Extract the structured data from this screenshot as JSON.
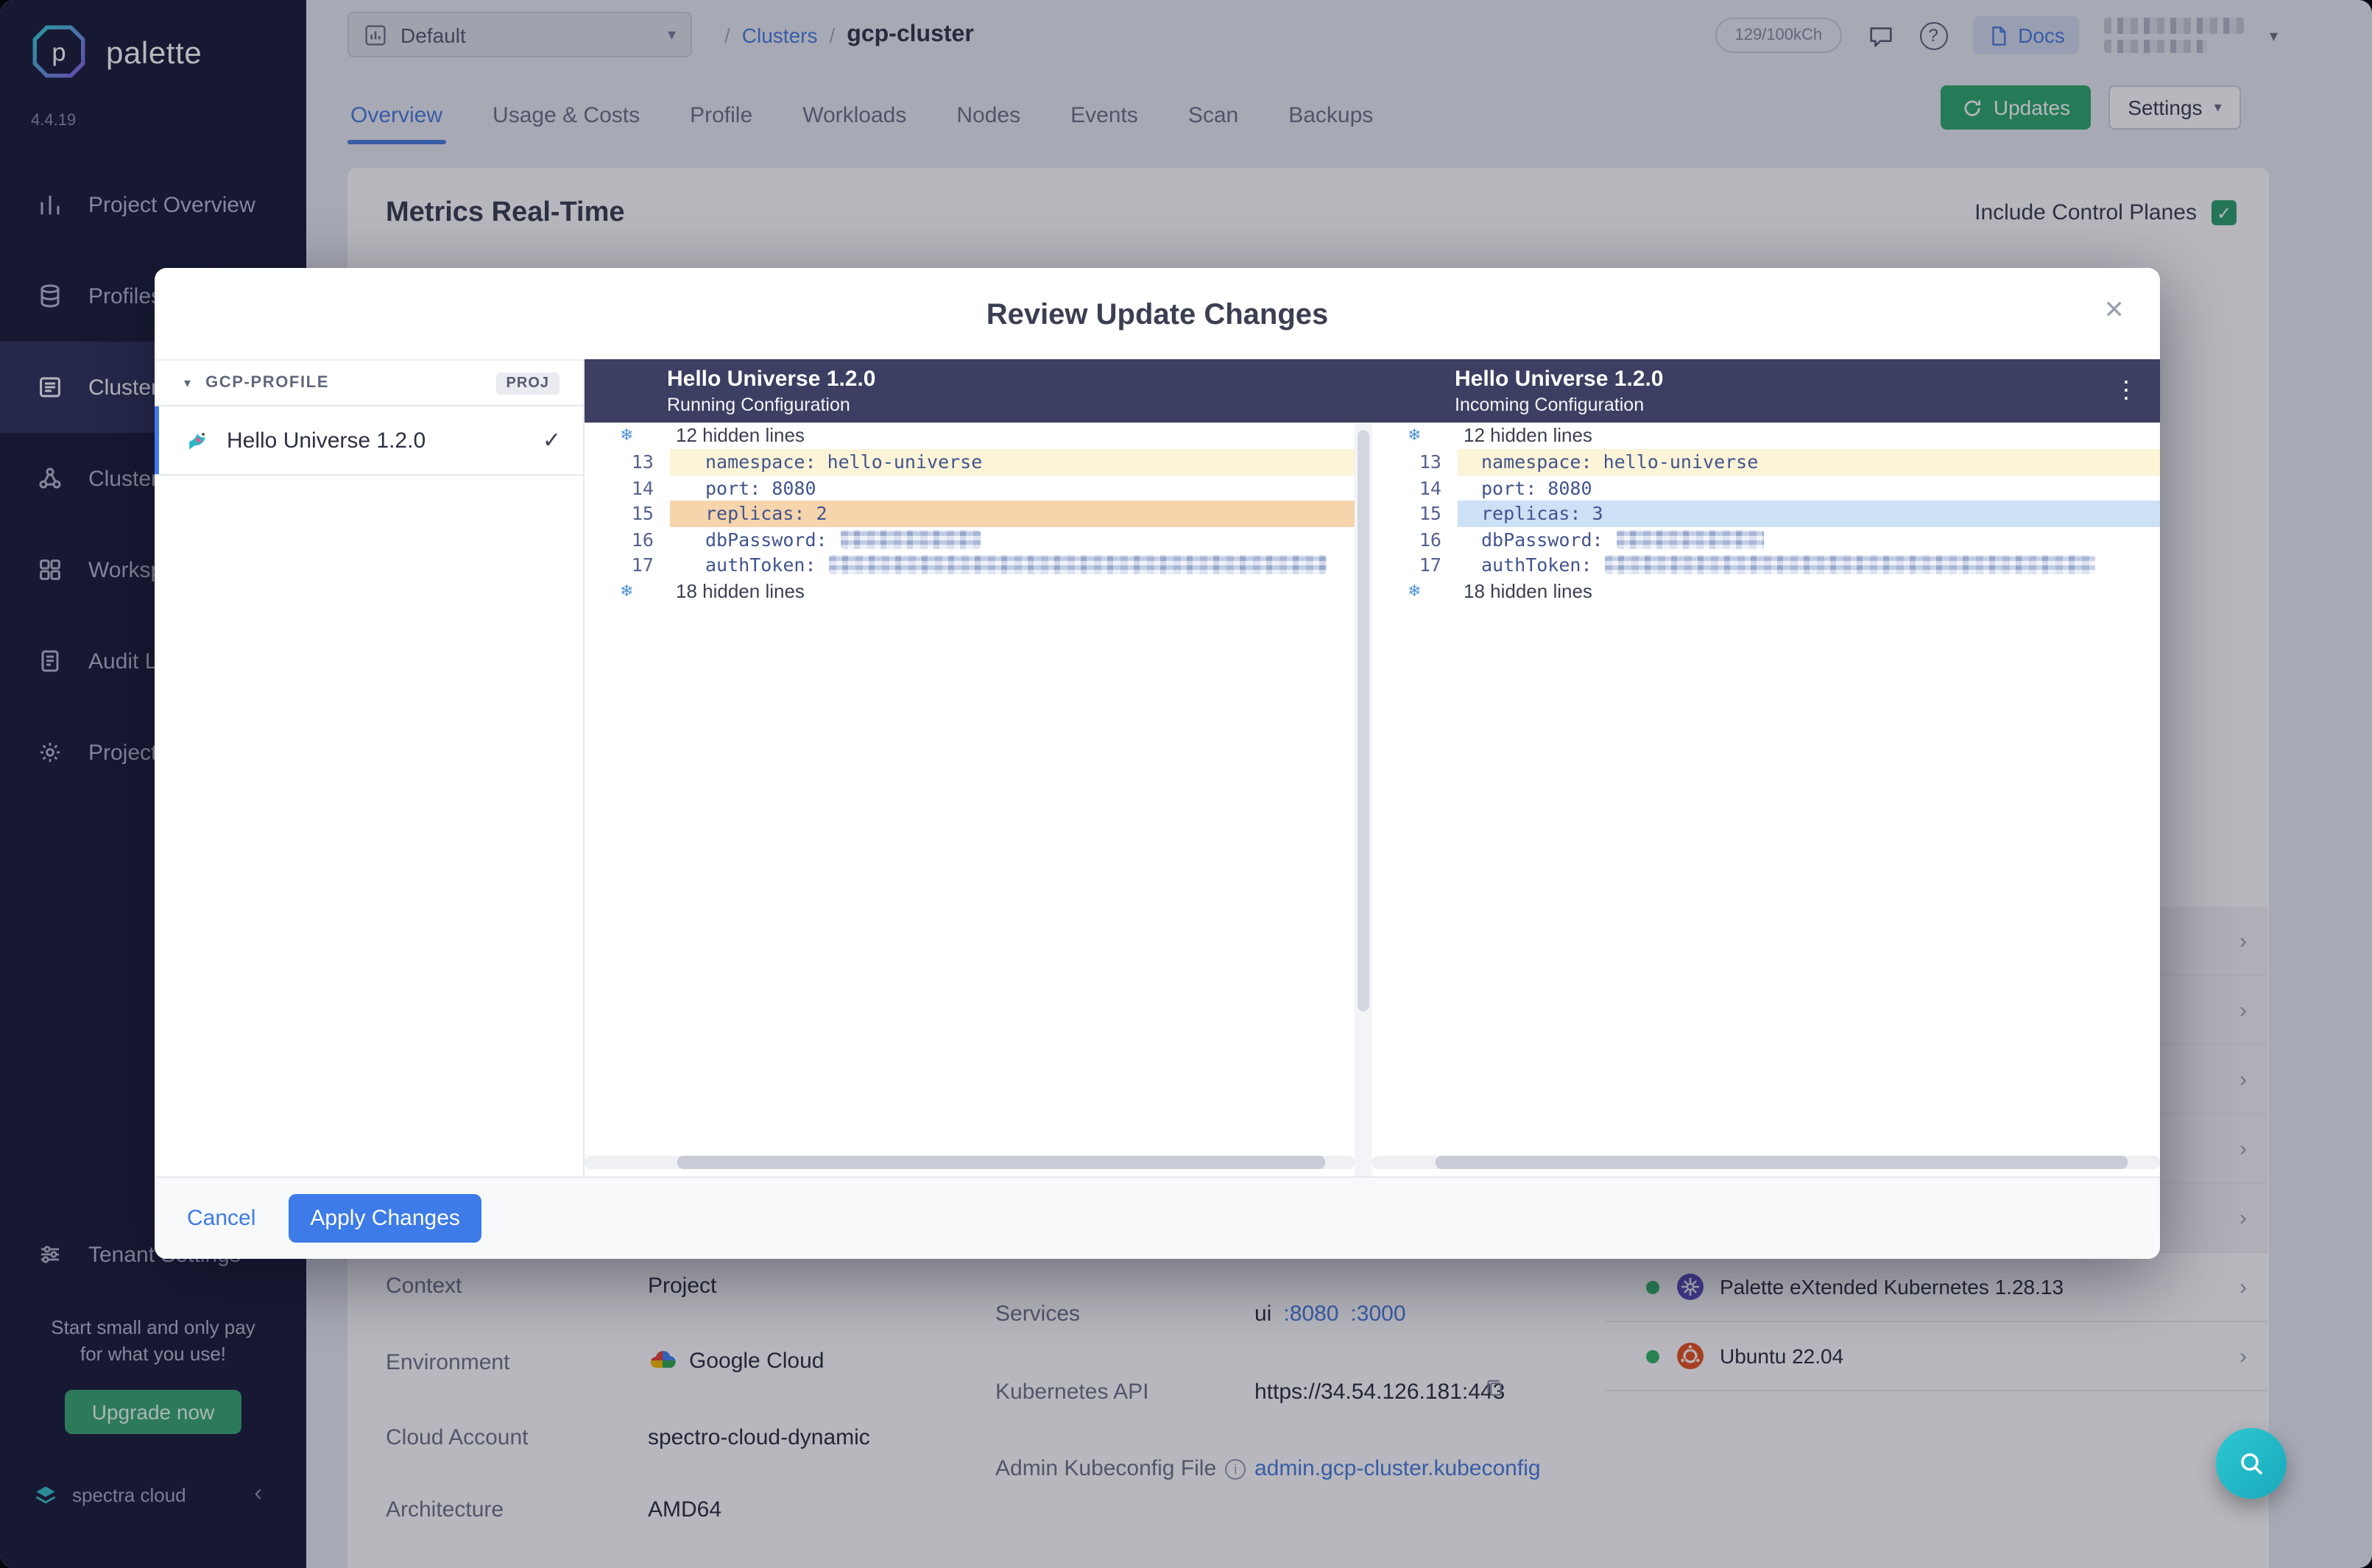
{
  "brand": {
    "name": "palette",
    "version": "4.4.19",
    "footer": "spectra cloud"
  },
  "icons": {
    "logo_letter": "p",
    "check": "✓",
    "close": "✕",
    "kebab": "⋮",
    "chevron_down": "▾",
    "collapse": "‹",
    "chevron_right": "›",
    "expand": "❄",
    "help": "?",
    "info": "i"
  },
  "colors": {
    "accent_blue": "#3D7BE8",
    "green": "#2FA96D",
    "teal_fab": "#23B3C2",
    "diff_yellow": "#FBF4D7",
    "diff_orange": "#F6D4AC",
    "diff_blue": "#CCE0F6",
    "diff_header_navy": "#3C3E62",
    "sidebar_navy": "#1B1C38"
  },
  "sidebar": {
    "items": [
      {
        "label": "Project Overview"
      },
      {
        "label": "Profiles"
      },
      {
        "label": "Clusters"
      },
      {
        "label": "Cluster Groups"
      },
      {
        "label": "Workspaces"
      },
      {
        "label": "Audit Logs"
      },
      {
        "label": "Project Settings"
      }
    ],
    "tenant_label": "Tenant Settings",
    "promo_line1": "Start small and only pay",
    "promo_line2": "for what you use!",
    "upgrade_label": "Upgrade now"
  },
  "topbar": {
    "project_select": "Default",
    "breadcrumb": {
      "sep": "/",
      "section": "Clusters",
      "current": "gcp-cluster"
    },
    "usage_pill": "129/100kCh",
    "docs_label": "Docs"
  },
  "tabs": [
    "Overview",
    "Usage & Costs",
    "Profile",
    "Workloads",
    "Nodes",
    "Events",
    "Scan",
    "Backups"
  ],
  "actions": {
    "updates_label": "Updates",
    "settings_label": "Settings"
  },
  "metrics": {
    "title": "Metrics Real-Time",
    "include_control_planes": "Include Control Planes"
  },
  "details": {
    "rows": [
      {
        "label": "Context",
        "value": "Project"
      },
      {
        "label": "Environment",
        "value": "Google Cloud"
      },
      {
        "label": "Cloud Account",
        "value": "spectro-cloud-dynamic"
      },
      {
        "label": "Architecture",
        "value": "AMD64"
      }
    ],
    "services_label": "Services",
    "services_value": "ui",
    "services_ports": [
      ":8080",
      ":3000"
    ],
    "k8s_api_label": "Kubernetes API",
    "k8s_api_value": "https://34.54.126.181:443",
    "kubeconfig_label": "Admin Kubeconfig File",
    "kubeconfig_value": "admin.gcp-cluster.kubeconfig",
    "packs": [
      {
        "name": "Palette eXtended Kubernetes 1.28.13"
      },
      {
        "name": "Ubuntu 22.04"
      }
    ]
  },
  "modal": {
    "title": "Review Update Changes",
    "profile_group": "GCP-PROFILE",
    "profile_scope": "PROJ",
    "profile_item": "Hello Universe 1.2.0",
    "cancel": "Cancel",
    "apply": "Apply Changes",
    "diff": {
      "left": {
        "title": "Hello Universe 1.2.0",
        "subtitle": "Running Configuration"
      },
      "right": {
        "title": "Hello Universe 1.2.0",
        "subtitle": "Incoming Configuration"
      },
      "hidden_top": "12 hidden lines",
      "hidden_bottom": "18 hidden lines",
      "lines_left": [
        {
          "num": "13",
          "text": "namespace: hello-universe"
        },
        {
          "num": "14",
          "text": "port: 8080"
        },
        {
          "num": "15",
          "text": "replicas: 2"
        },
        {
          "num": "16",
          "text": "dbPassword:"
        },
        {
          "num": "17",
          "text": "authToken:"
        }
      ],
      "lines_right": [
        {
          "num": "13",
          "text": "namespace: hello-universe"
        },
        {
          "num": "14",
          "text": "port: 8080"
        },
        {
          "num": "15",
          "text": "replicas: 3"
        },
        {
          "num": "16",
          "text": "dbPassword:"
        },
        {
          "num": "17",
          "text": "authToken:"
        }
      ]
    }
  }
}
